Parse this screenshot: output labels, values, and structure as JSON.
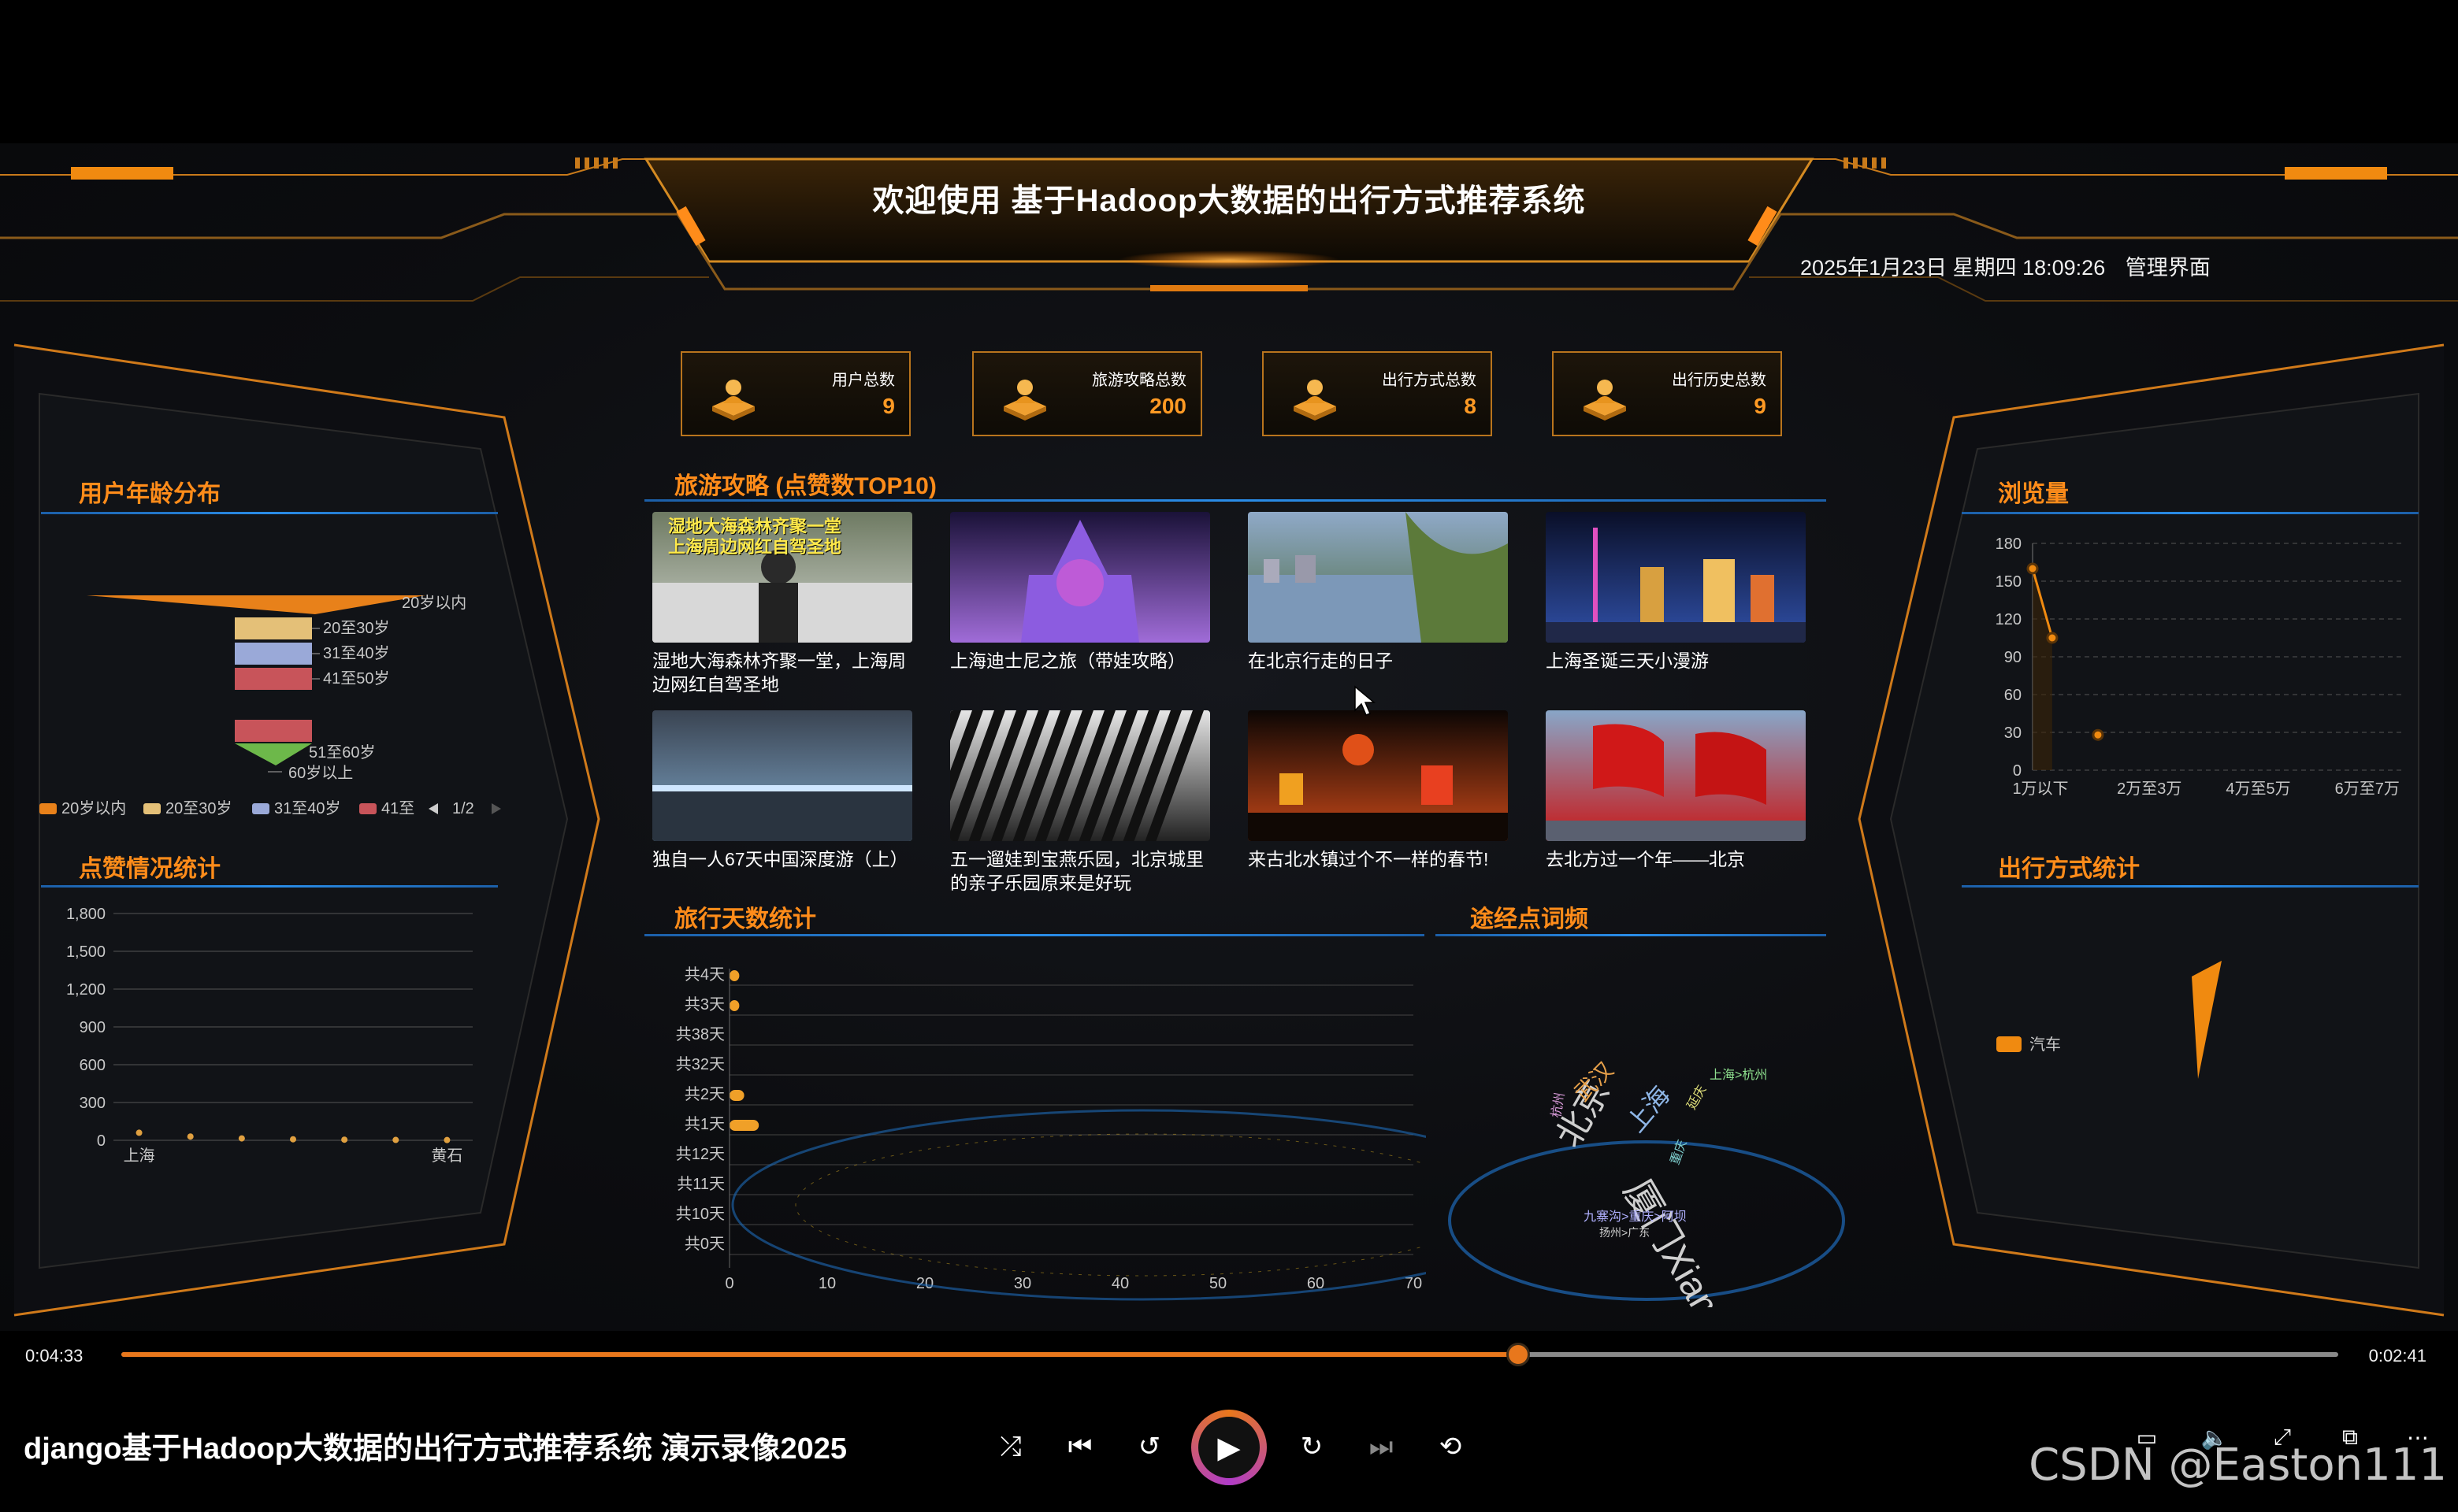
{
  "header": {
    "title": "欢迎使用 基于Hadoop大数据的出行方式推荐系统",
    "datetime": "2025年1月23日 星期四 18:09:26",
    "admin_link": "管理界面"
  },
  "stats": [
    {
      "label": "用户总数",
      "value": "9",
      "icon": "user-icon"
    },
    {
      "label": "旅游攻略总数",
      "value": "200",
      "icon": "guide-icon"
    },
    {
      "label": "出行方式总数",
      "value": "8",
      "icon": "transport-icon"
    },
    {
      "label": "出行历史总数",
      "value": "9",
      "icon": "history-icon"
    }
  ],
  "sections": {
    "age": "用户年龄分布",
    "likes": "点赞情况统计",
    "guides": "旅游攻略 (点赞数TOP10)",
    "days": "旅行天数统计",
    "words": "途经点词频",
    "views": "浏览量",
    "transport": "出行方式统计"
  },
  "guides": [
    {
      "caption": "湿地大海森林齐聚一堂，上海周边网红自驾圣地",
      "overlay": "湿地大海森林齐聚一堂\n上海周边网红自驾圣地"
    },
    {
      "caption": "上海迪士尼之旅（带娃攻略）",
      "overlay": ""
    },
    {
      "caption": "在北京行走的日子",
      "overlay": ""
    },
    {
      "caption": "上海圣诞三天小漫游",
      "overlay": ""
    },
    {
      "caption": "独自一人67天中国深度游（上）",
      "overlay": ""
    },
    {
      "caption": "五一遛娃到宝燕乐园，北京城里的亲子乐园原来是好玩",
      "overlay": ""
    },
    {
      "caption": "来古北水镇过个不一样的春节!",
      "overlay": ""
    },
    {
      "caption": "去北方过一个年——北京",
      "overlay": ""
    }
  ],
  "chart_data": [
    {
      "type": "funnel",
      "title": "用户年龄分布",
      "categories": [
        "20岁以内",
        "20至30岁",
        "31至40岁",
        "41至50岁",
        "51至60岁",
        "60岁以上"
      ],
      "colors": [
        "#e8811a",
        "#e4c078",
        "#9aa9d8",
        "#c8545a",
        "#6db84a",
        "#67b7e0"
      ],
      "legend": [
        "20岁以内",
        "20至30岁",
        "31至40岁",
        "41至"
      ],
      "legend_page": "1/2"
    },
    {
      "type": "area",
      "title": "点赞情况统计",
      "categories": [
        "上海",
        "",
        "",
        "",
        "",
        "",
        "黄石"
      ],
      "values": [
        60,
        30,
        15,
        8,
        5,
        3,
        2
      ],
      "yticks": [
        "0",
        "300",
        "600",
        "900",
        "1,200",
        "1,500",
        "1,800"
      ],
      "ylim": [
        0,
        1800
      ]
    },
    {
      "type": "bar",
      "title": "旅行天数统计",
      "categories": [
        "共4天",
        "共3天",
        "共38天",
        "共32天",
        "共2天",
        "共1天",
        "共12天",
        "共11天",
        "共10天",
        "共0天"
      ],
      "values": [
        1,
        1,
        0,
        0,
        1.5,
        3,
        0,
        0,
        0,
        0
      ],
      "xticks": [
        "0",
        "10",
        "20",
        "30",
        "40",
        "50",
        "60",
        "70"
      ],
      "xlim": [
        0,
        70
      ]
    },
    {
      "type": "line",
      "title": "浏览量",
      "categories": [
        "1万以下",
        "2万至3万",
        "4万至5万",
        "6万至7万"
      ],
      "points": [
        {
          "x": 0,
          "y": 160
        },
        {
          "x": 0.15,
          "y": 105
        },
        {
          "x": 0.5,
          "y": 28
        }
      ],
      "yticks": [
        "0",
        "30",
        "60",
        "90",
        "120",
        "150",
        "180"
      ],
      "ylim": [
        0,
        180
      ]
    },
    {
      "type": "pie",
      "title": "出行方式统计",
      "legend": [
        "汽车"
      ],
      "colors": [
        "#f08a10"
      ]
    }
  ],
  "wordcloud": [
    {
      "text": "北京",
      "color": "#cfcfcf"
    },
    {
      "text": "厦门Xiamen",
      "color": "#cfcfcf"
    },
    {
      "text": "上海",
      "color": "#8fb7e8"
    },
    {
      "text": "武汉",
      "color": "#e6a04a"
    },
    {
      "text": "上海>杭州",
      "color": "#8ee08e"
    },
    {
      "text": "九寨沟>重庆>阿坝",
      "color": "#b0b0ff"
    },
    {
      "text": "扬州>广东",
      "color": "#cfcfcf"
    },
    {
      "text": "延庆",
      "color": "#e0e07a"
    },
    {
      "text": "重庆",
      "color": "#7fd0d0"
    },
    {
      "text": "杭州",
      "color": "#d89ad8"
    }
  ],
  "player": {
    "elapsed": "0:04:33",
    "remaining": "0:02:41",
    "progress": 0.63,
    "title": "django基于Hadoop大数据的出行方式推荐系统 演示录像2025",
    "watermark": "CSDN @Easton111"
  }
}
